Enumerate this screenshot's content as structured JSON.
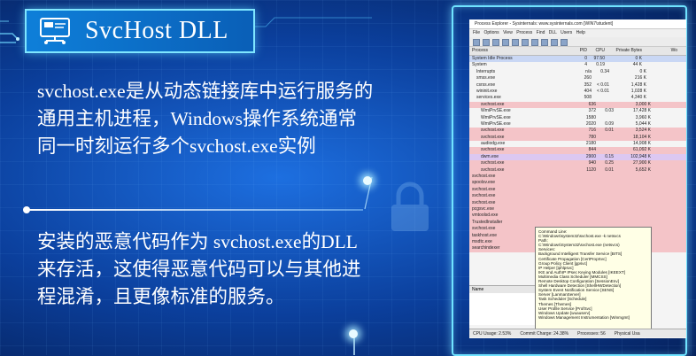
{
  "title": "SvcHost DLL",
  "paragraph1": "svchost.exe是从动态链接库中运行服务的通用主机进程，Windows操作系统通常同一时刻运行多个svchost.exe实例",
  "paragraph2": "安装的恶意代码作为 svchost.exe的DLL来存活，这使得恶意代码可以与其他进程混淆，且更像标准的服务。",
  "screenshot": {
    "window_title": "Process Explorer - Sysinternals: www.sysinternals.com [WIN7\\student]",
    "menu": "File  Options  View  Process  Find  DLL  Users  Help",
    "columns": [
      "Process",
      "PID",
      "CPU",
      "Private Bytes",
      "Wo"
    ],
    "rows": [
      {
        "name": "System Idle Process",
        "pid": "0",
        "cpu": "97.50",
        "priv": "0 K",
        "style": "blue"
      },
      {
        "name": "System",
        "pid": "4",
        "cpu": "0.19",
        "priv": "44 K",
        "style": ""
      },
      {
        "name": "Interrupts",
        "pid": "n/a",
        "cpu": "0.34",
        "priv": "0 K",
        "style": ""
      },
      {
        "name": "smss.exe",
        "pid": "260",
        "cpu": "",
        "priv": "216 K",
        "style": ""
      },
      {
        "name": "csrss.exe",
        "pid": "352",
        "cpu": "< 0.01",
        "priv": "1,428 K",
        "style": ""
      },
      {
        "name": "wininit.exe",
        "pid": "404",
        "cpu": "< 0.01",
        "priv": "1,028 K",
        "style": ""
      },
      {
        "name": "services.exe",
        "pid": "508",
        "cpu": "",
        "priv": "4,340 K",
        "style": ""
      },
      {
        "name": "svchost.exe",
        "pid": "636",
        "cpu": "",
        "priv": "3,000 K",
        "style": "pink"
      },
      {
        "name": "WmiPrvSE.exe",
        "pid": "372",
        "cpu": "0.03",
        "priv": "17,428 K",
        "style": ""
      },
      {
        "name": "WmiPrvSE.exe",
        "pid": "1580",
        "cpu": "",
        "priv": "3,960 K",
        "style": ""
      },
      {
        "name": "WmiPrvSE.exe",
        "pid": "2020",
        "cpu": "0.09",
        "priv": "5,044 K",
        "style": ""
      },
      {
        "name": "svchost.exe",
        "pid": "716",
        "cpu": "0.01",
        "priv": "3,524 K",
        "style": "pink"
      },
      {
        "name": "svchost.exe",
        "pid": "780",
        "cpu": "",
        "priv": "18,104 K",
        "style": "pink"
      },
      {
        "name": "audiodg.exe",
        "pid": "2180",
        "cpu": "",
        "priv": "14,908 K",
        "style": ""
      },
      {
        "name": "svchost.exe",
        "pid": "844",
        "cpu": "",
        "priv": "61,092 K",
        "style": "pink"
      },
      {
        "name": "dwm.exe",
        "pid": "2900",
        "cpu": "0.15",
        "priv": "102,948 K",
        "style": "purple"
      },
      {
        "name": "svchost.exe",
        "pid": "940",
        "cpu": "0.25",
        "priv": "27,900 K",
        "style": "pink"
      },
      {
        "name": "svchost.exe",
        "pid": "1120",
        "cpu": "0.01",
        "priv": "5,652 K",
        "style": "pink"
      },
      {
        "name": "svchost.exe",
        "pid": "",
        "cpu": "",
        "priv": "",
        "style": "pink"
      },
      {
        "name": "spoolsv.exe",
        "pid": "",
        "cpu": "",
        "priv": "",
        "style": "pink"
      },
      {
        "name": "svchost.exe",
        "pid": "",
        "cpu": "",
        "priv": "",
        "style": "pink"
      },
      {
        "name": "svchost.exe",
        "pid": "",
        "cpu": "",
        "priv": "",
        "style": "pink"
      },
      {
        "name": "svchost.exe",
        "pid": "",
        "cpu": "",
        "priv": "",
        "style": "pink"
      },
      {
        "name": "pcgsvc.exe",
        "pid": "",
        "cpu": "",
        "priv": "",
        "style": "pink"
      },
      {
        "name": "vmtoolsd.exe",
        "pid": "",
        "cpu": "",
        "priv": "",
        "style": "pink"
      },
      {
        "name": "TrustedInstaller",
        "pid": "",
        "cpu": "",
        "priv": "",
        "style": "pink"
      },
      {
        "name": "svchost.exe",
        "pid": "",
        "cpu": "",
        "priv": "",
        "style": "pink"
      },
      {
        "name": "taskhost.exe",
        "pid": "",
        "cpu": "",
        "priv": "",
        "style": "pink"
      },
      {
        "name": "msdtc.exe",
        "pid": "",
        "cpu": "",
        "priv": "",
        "style": "pink"
      },
      {
        "name": "searchindexer",
        "pid": "",
        "cpu": "",
        "priv": "",
        "style": "pink"
      }
    ],
    "tooltip_lines": [
      "Command Line:",
      "C:\\Windows\\system32\\svchost.exe -k netsvcs",
      "Path:",
      "C:\\Windows\\System32\\svchost.exe (netsvcs)",
      "Services:",
      "Background Intelligent Transfer Service [BITS]",
      "Certificate Propagation [CertPropSvc]",
      "Group Policy Client [gpsvc]",
      "IP Helper [iphlpsvc]",
      "IKE and AuthIP IPsec Keying Modules [IKEEXT]",
      "Multimedia Class Scheduler [MMCSS]",
      "Remote Desktop Configuration [SessionEnv]",
      "Shell Hardware Detection [ShellHWDetection]",
      "System Event Notification Service [SENS]",
      "Server [LanmanServer]",
      "Task Scheduler [Schedule]",
      "Themes [Themes]",
      "User Profile Service [ProfSvc]",
      "Windows Update [wuauserv]",
      "Windows Management Instrumentation [Winmgmt]"
    ],
    "lower_pane_header": "Name",
    "status": [
      "CPU Usage: 2.53%",
      "Commit Charge: 24.38%",
      "Processes: 56",
      "Physical Usa"
    ]
  }
}
